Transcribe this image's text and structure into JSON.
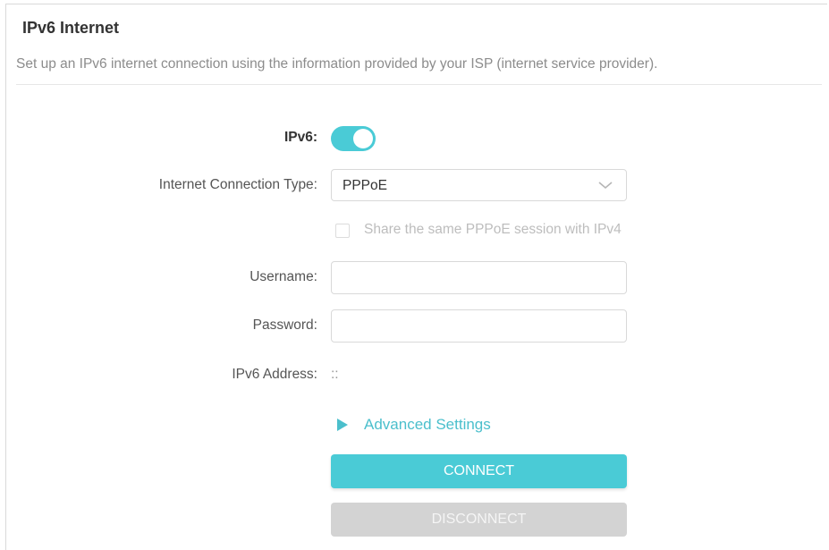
{
  "header": {
    "title": "IPv6 Internet",
    "description": "Set up an IPv6 internet connection using the information provided by your ISP (internet service provider)."
  },
  "form": {
    "ipv6": {
      "label": "IPv6:",
      "enabled": true
    },
    "connection_type": {
      "label": "Internet Connection Type:",
      "value": "PPPoE"
    },
    "share_session": {
      "label": "Share the same PPPoE session with IPv4",
      "checked": false,
      "disabled": true
    },
    "username": {
      "label": "Username:",
      "value": "",
      "placeholder": ""
    },
    "password": {
      "label": "Password:",
      "value": "",
      "placeholder": ""
    },
    "ipv6_address": {
      "label": "IPv6 Address:",
      "value": "::"
    },
    "advanced": {
      "label": "Advanced Settings"
    }
  },
  "buttons": {
    "connect_label": "CONNECT",
    "disconnect_label": "DISCONNECT"
  },
  "colors": {
    "accent": "#4acbd6",
    "link": "#4bbfcc",
    "disabled_button": "#d3d3d3",
    "border": "#d9d9d9"
  },
  "icons": {
    "connection_type_dropdown": "chevron-down-icon",
    "advanced_expand": "triangle-right-icon"
  }
}
